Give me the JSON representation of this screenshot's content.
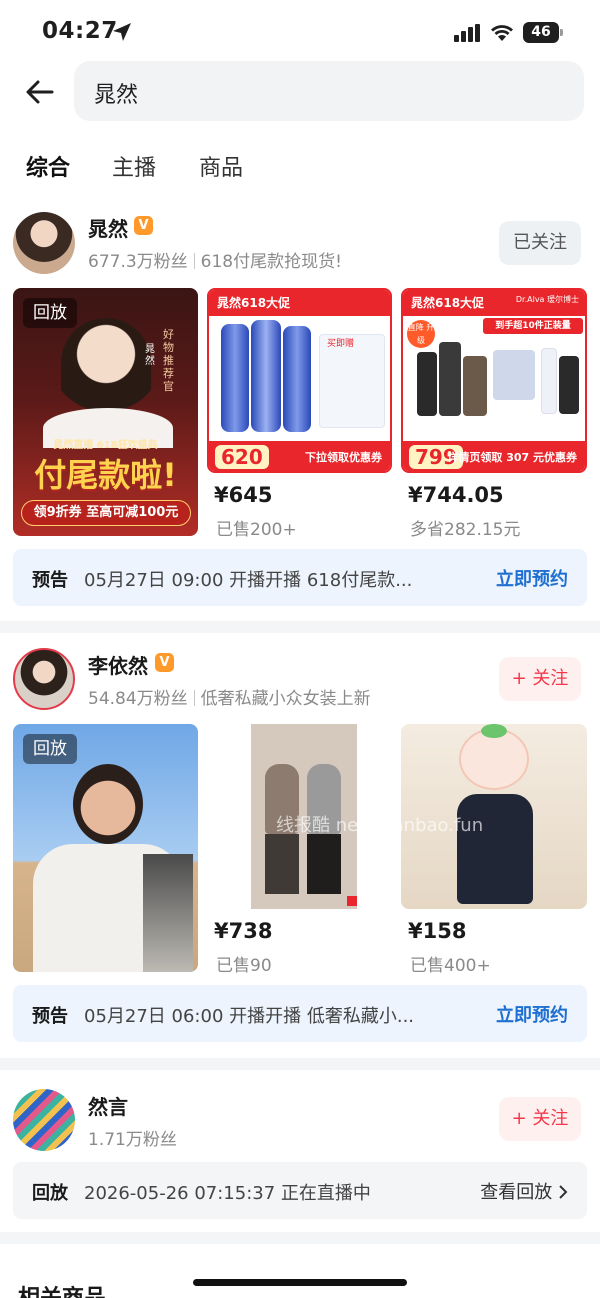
{
  "status_bar": {
    "time": "04:27",
    "battery": "46"
  },
  "search": {
    "query": "晁然"
  },
  "tabs": [
    "综合",
    "主播",
    "商品"
  ],
  "results": [
    {
      "name": "晁然",
      "verified_badge": "V",
      "fans": "677.3万粉丝",
      "desc": "618付尾款抢现货!",
      "follow_label": "已关注",
      "replay_tag": "回放",
      "live_cover_text": {
        "banner": "付尾款啦!",
        "promo": "领9折券 至高可减100元",
        "side": "好物推荐官",
        "side_name": "晁然",
        "event": "晁然直播 618狂欢盛典"
      },
      "products": [
        {
          "price": "¥645",
          "sold": "已售200+",
          "badge_head": "晁然618大促",
          "badge_num": "620",
          "badge_foot": "下拉领取优惠券",
          "extra": "买即赠"
        },
        {
          "price": "¥744.05",
          "sold": "多省282.15元",
          "badge_head": "晁然618大促",
          "badge_num": "799",
          "badge_foot": "详情页领取 307 元优惠券",
          "extra": "到手超10件正装量",
          "brand": "Dr.Alva 瑷尔博士",
          "tag": "直降 升级"
        }
      ],
      "notice": {
        "tag": "预告",
        "text": "05月27日 09:00 开播开播 618付尾款...",
        "action": "立即预约"
      }
    },
    {
      "name": "李依然",
      "verified_badge": "V",
      "fans": "54.84万粉丝",
      "desc": "低奢私藏小众女装上新",
      "follow_label": "+ 关注",
      "replay_tag": "回放",
      "products": [
        {
          "price": "¥738",
          "sold": "已售90"
        },
        {
          "price": "¥158",
          "sold": "已售400+"
        }
      ],
      "notice": {
        "tag": "预告",
        "text": "05月27日 06:00 开播开播 低奢私藏小...",
        "action": "立即预约"
      }
    },
    {
      "name": "然言",
      "fans": "1.71万粉丝",
      "follow_label": "+ 关注",
      "replay": {
        "tag": "回放",
        "text": "2026-05-26 07:15:37 正在直播中",
        "action": "查看回放"
      }
    }
  ],
  "watermark": "线报酷 new.xianbao.fun",
  "related_title": "相关商品",
  "colors": {
    "accent_blue": "#1f6fd1",
    "follow_red": "#f2384a",
    "promo_red": "#e8262b"
  }
}
